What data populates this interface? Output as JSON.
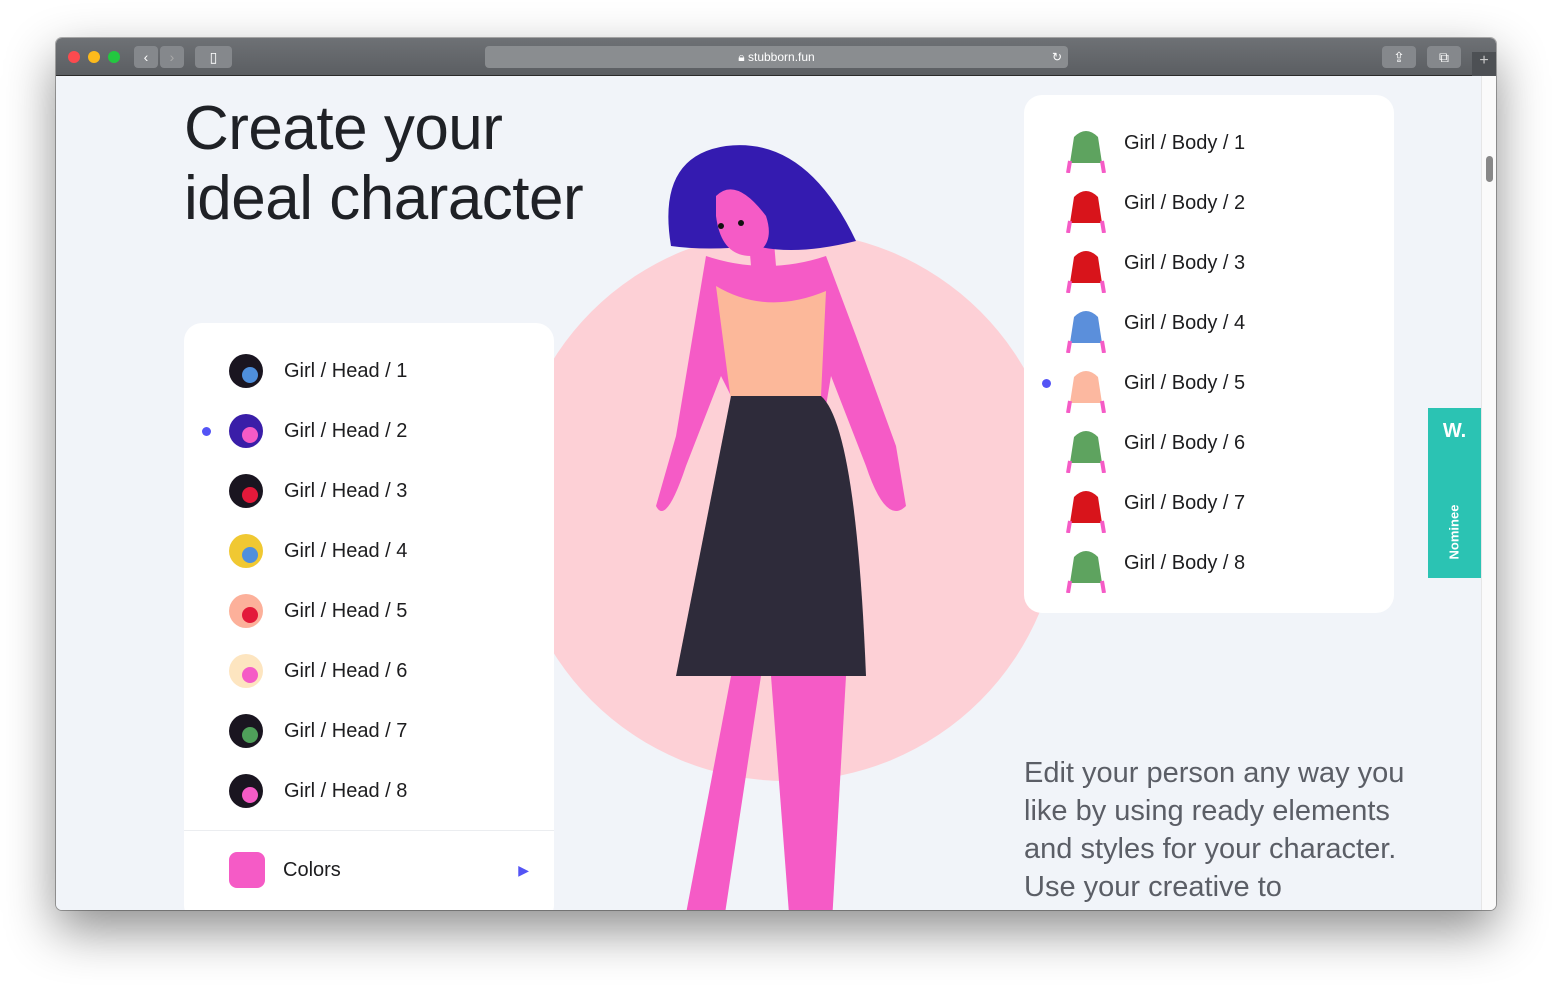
{
  "browser": {
    "url": "stubborn.fun"
  },
  "hero": {
    "title_line1": "Create your",
    "title_line2": "ideal character"
  },
  "heads": {
    "selected": 1,
    "items": [
      {
        "label": "Girl / Head / 1",
        "color": "#1a1520",
        "face": "#4f8fdc"
      },
      {
        "label": "Girl / Head / 2",
        "color": "#3a1ea8",
        "face": "#f55bc6"
      },
      {
        "label": "Girl / Head / 3",
        "color": "#1a1520",
        "face": "#e3193a"
      },
      {
        "label": "Girl / Head / 4",
        "color": "#f0c832",
        "face": "#4f8fdc"
      },
      {
        "label": "Girl / Head / 5",
        "color": "#fcb09a",
        "face": "#e3193a"
      },
      {
        "label": "Girl / Head / 6",
        "color": "#fde5c0",
        "face": "#f55bc6"
      },
      {
        "label": "Girl / Head / 7",
        "color": "#1a1520",
        "face": "#4fa05a"
      },
      {
        "label": "Girl / Head / 8",
        "color": "#1a1520",
        "face": "#f55bc6"
      }
    ]
  },
  "colors": {
    "label": "Colors",
    "swatch": "#f55bc6"
  },
  "bodies": {
    "selected": 4,
    "items": [
      {
        "label": "Girl / Body / 1",
        "color": "#5ea35f"
      },
      {
        "label": "Girl / Body / 2",
        "color": "#d8141b"
      },
      {
        "label": "Girl / Body / 3",
        "color": "#d8141b"
      },
      {
        "label": "Girl / Body / 4",
        "color": "#5b8fdb"
      },
      {
        "label": "Girl / Body / 5",
        "color": "#fcb8a0"
      },
      {
        "label": "Girl / Body / 6",
        "color": "#5ea35f"
      },
      {
        "label": "Girl / Body / 7",
        "color": "#d8141b"
      },
      {
        "label": "Girl / Body / 8",
        "color": "#5ea35f"
      }
    ]
  },
  "description": "Edit your person any way you like by using ready elements and styles for your character. Use your creative to",
  "badge": {
    "logo": "W.",
    "label": "Nominee"
  }
}
